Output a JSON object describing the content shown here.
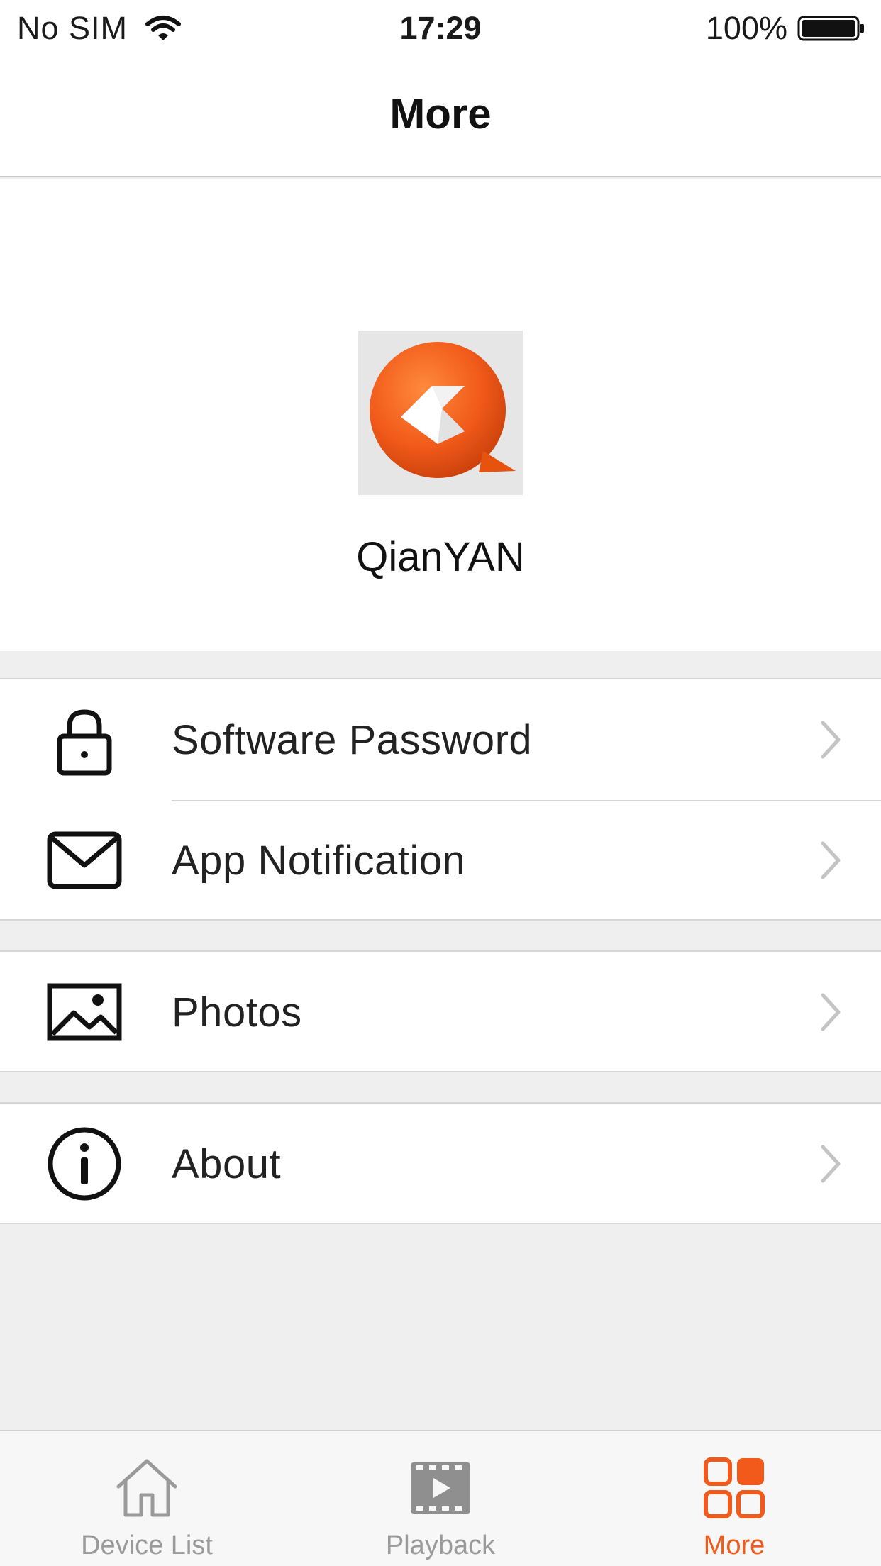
{
  "status_bar": {
    "carrier": "No SIM",
    "time": "17:29",
    "battery": "100%"
  },
  "nav": {
    "title": "More"
  },
  "app": {
    "name": "QianYAN",
    "logo_icon": "qianyan-logo",
    "brand_color": "#f15a1a"
  },
  "menu": {
    "software_password": {
      "label": "Software Password",
      "icon": "lock-icon"
    },
    "app_notification": {
      "label": "App Notification",
      "icon": "mail-icon"
    },
    "photos": {
      "label": "Photos",
      "icon": "image-icon"
    },
    "about": {
      "label": "About",
      "icon": "info-icon"
    }
  },
  "tabs": [
    {
      "label": "Device List",
      "icon": "home-icon",
      "active": false
    },
    {
      "label": "Playback",
      "icon": "playback-icon",
      "active": false
    },
    {
      "label": "More",
      "icon": "grid-icon",
      "active": true
    }
  ],
  "colors": {
    "accent": "#f15a1a",
    "inactive": "#9a9a9a"
  }
}
